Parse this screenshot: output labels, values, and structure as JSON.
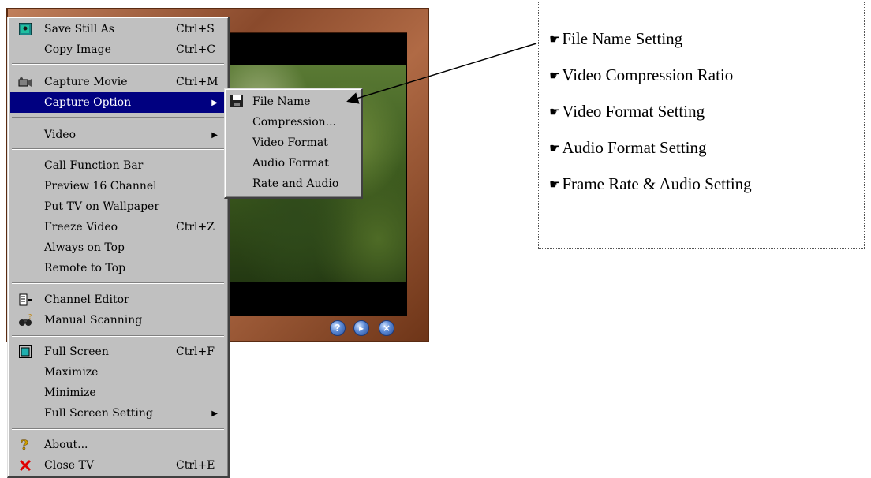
{
  "menu": {
    "items": [
      {
        "label": "Save Still As",
        "shortcut": "Ctrl+S",
        "icon": "save-still-icon"
      },
      {
        "label": "Copy Image",
        "shortcut": "Ctrl+C"
      },
      {
        "label": "Capture Movie",
        "shortcut": "Ctrl+M",
        "icon": "camera-icon"
      },
      {
        "label": "Capture Option",
        "selected": true,
        "submenu": true
      },
      {
        "label": "Video",
        "submenu": true
      },
      {
        "label": "Call Function Bar"
      },
      {
        "label": "Preview 16 Channel"
      },
      {
        "label": "Put TV on Wallpaper"
      },
      {
        "label": "Freeze Video",
        "shortcut": "Ctrl+Z"
      },
      {
        "label": "Always on Top"
      },
      {
        "label": "Remote to Top"
      },
      {
        "label": "Channel Editor",
        "icon": "channel-editor-icon"
      },
      {
        "label": "Manual Scanning",
        "icon": "binoculars-icon"
      },
      {
        "label": "Full Screen",
        "shortcut": "Ctrl+F",
        "icon": "fullscreen-icon"
      },
      {
        "label": "Maximize"
      },
      {
        "label": "Minimize"
      },
      {
        "label": "Full Screen Setting",
        "submenu": true
      },
      {
        "label": "About...",
        "icon": "question-icon"
      },
      {
        "label": "Close TV",
        "shortcut": "Ctrl+E",
        "icon": "close-icon"
      }
    ]
  },
  "submenu": {
    "items": [
      {
        "label": "File Name",
        "icon": "floppy-icon"
      },
      {
        "label": "Compression..."
      },
      {
        "label": "Video Format"
      },
      {
        "label": "Audio Format"
      },
      {
        "label": "Rate and Audio"
      }
    ]
  },
  "callout": {
    "items": [
      "File Name Setting",
      "Video Compression Ratio",
      "Video Format Setting",
      "Audio Format Setting",
      "Frame Rate & Audio Setting"
    ]
  },
  "tv_buttons": [
    "?",
    "▸",
    "×"
  ],
  "colors": {
    "highlight": "#000080",
    "menu_bg": "#c0c0c0",
    "frame": "#9a5a38"
  }
}
